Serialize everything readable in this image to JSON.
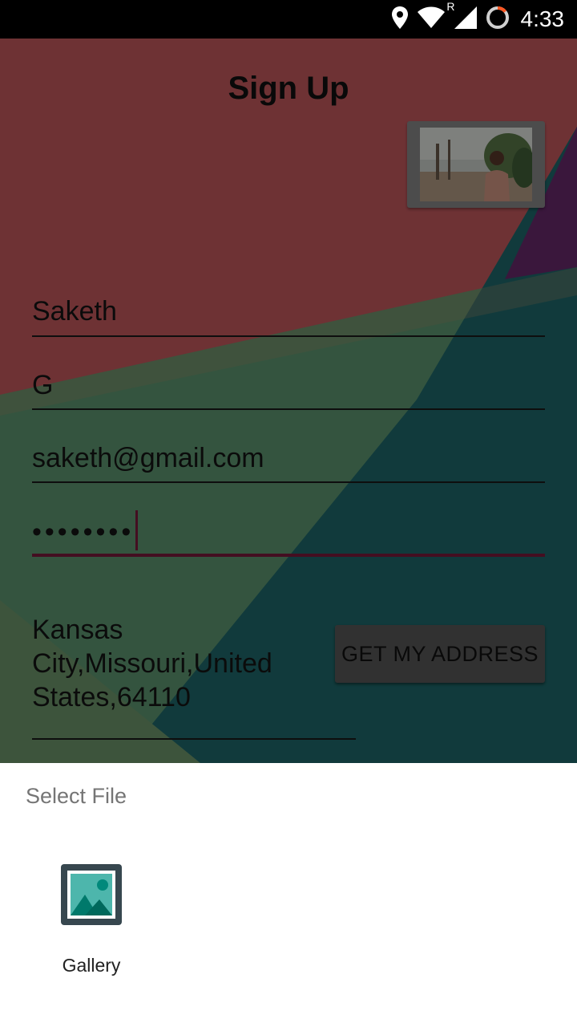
{
  "status_bar": {
    "time": "4:33",
    "icons": [
      "location-icon",
      "wifi-icon",
      "roaming-indicator",
      "signal-icon",
      "battery-icon"
    ],
    "roaming_label": "R"
  },
  "signup": {
    "title": "Sign Up",
    "fields": {
      "first_name": "Saketh",
      "last_name": "G",
      "email": "saketh@gmail.com",
      "password": "••••••••"
    },
    "address": "Kansas City,Missouri,United States,64110",
    "get_address_label": "GET MY ADDRESS",
    "accent_color": "#7d1a3d"
  },
  "sheet": {
    "title": "Select File",
    "options": [
      {
        "label": "Gallery",
        "icon": "gallery-icon"
      }
    ]
  }
}
